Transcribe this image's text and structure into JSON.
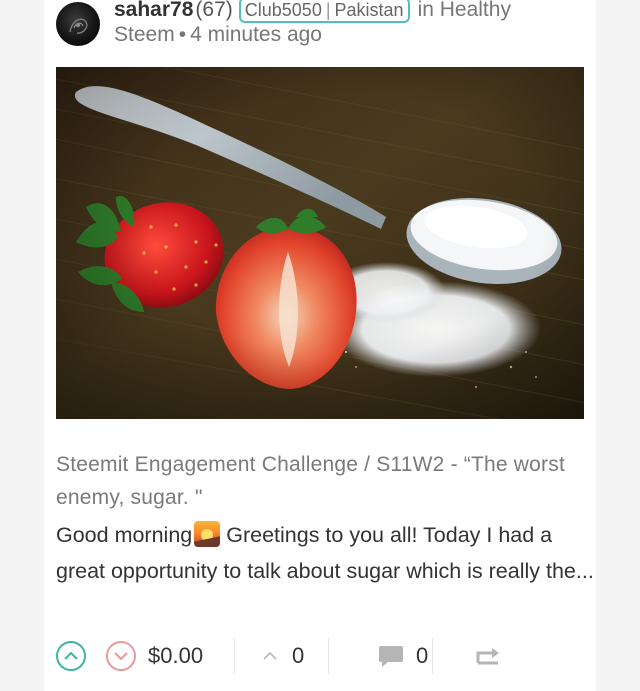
{
  "post": {
    "author": "sahar78",
    "reputation": "(67)",
    "tag_primary": "Club5050",
    "tag_secondary": "Pakistan",
    "community_prefix": "in Healthy",
    "community_suffix": "Steem",
    "time_ago": "4 minutes ago",
    "title": "Steemit Engagement Challenge / S11W2 - “The worst enemy,  sugar. \"",
    "excerpt_before_emoji": "Good morning",
    "excerpt_after_emoji": "Greetings to you all! Today I had a great opportunity to talk about sugar which is really the...",
    "image_description_icon": "strawberries-and-sugar-spoon-photo"
  },
  "footer": {
    "payout": "$0.00",
    "votes_count": "0",
    "comments_count": "0"
  },
  "colors": {
    "upvote": "#3ab59f",
    "downvote": "#e99a9a",
    "tag_border": "#4fc2b8",
    "title_text": "#7a7a7a",
    "body_text": "#333333"
  }
}
